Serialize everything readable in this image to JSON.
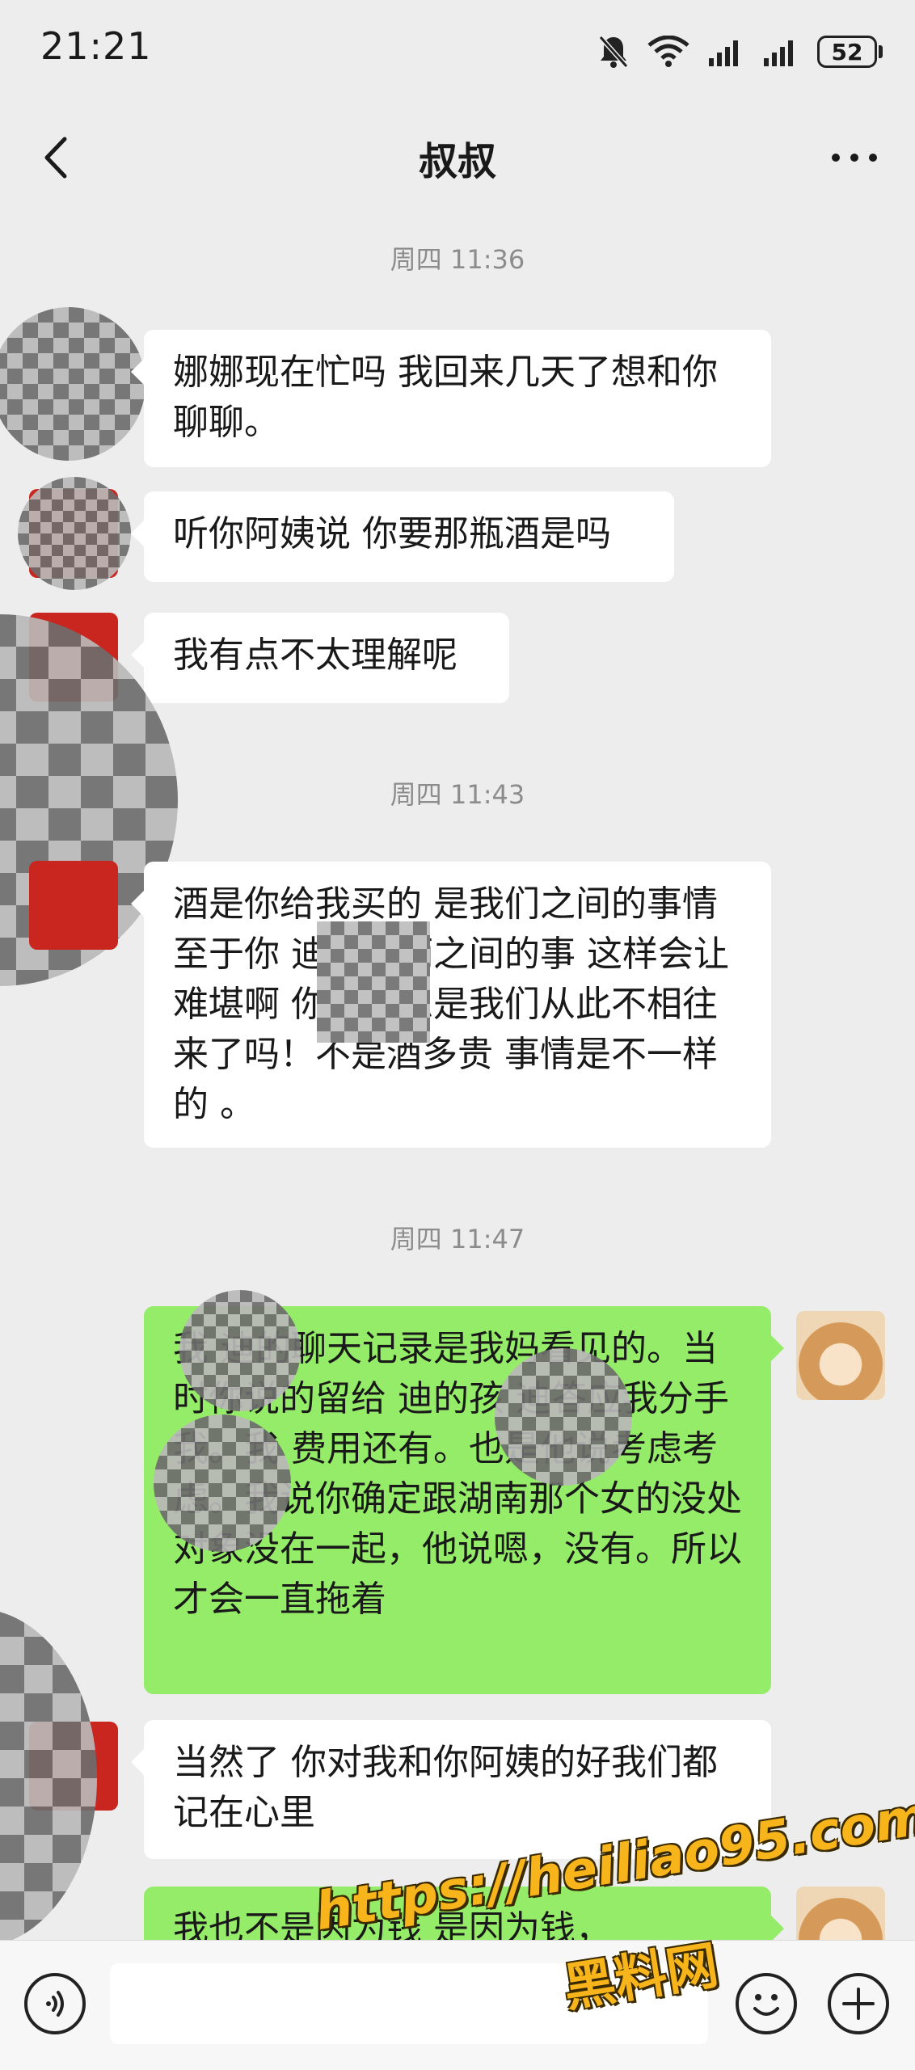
{
  "status_bar": {
    "time": "21:21",
    "battery": "52"
  },
  "header": {
    "title": "叔叔"
  },
  "chat": {
    "timestamps": [
      "周四 11:36",
      "周四 11:43",
      "周四 11:47"
    ],
    "messages": [
      {
        "side": "in",
        "text": "娜娜现在忙吗 我回来几天了想和你聊聊。"
      },
      {
        "side": "in",
        "text": "听你阿姨说 你要那瓶酒是吗"
      },
      {
        "side": "in",
        "text": "我有点不太理解呢"
      },
      {
        "side": "in",
        "text": "酒是你给我买的 是我们之间的事情 至于你 迪是你俩之间的事 这样会让 难堪啊 你的意思是我们从此不相往来了吗！不是酒多贵 事情是不一样的 。"
      },
      {
        "side": "out",
        "text": "我 迪的聊天记录是我妈看见的。当时你说的留给 迪的孩 迪答应我分手 我。我 费用还有。也是他说考虑考虑。我说你确定跟湖南那个女的没处对象没在一起，他说嗯，没有。所以才会一直拖着"
      },
      {
        "side": "in",
        "text": "当然了 你对我和你阿姨的好我们都记在心里"
      },
      {
        "side": "out",
        "text": "我也不是因为钱 是因为钱，"
      }
    ]
  },
  "watermark": {
    "url": "https://heiliao95.com",
    "name": "黑料网"
  },
  "icons": {
    "back": "chevron-left-icon",
    "more": "more-dots-icon",
    "voice": "voice-icon",
    "emoji": "emoji-icon",
    "plus": "plus-icon",
    "mute": "mute-bell-icon",
    "wifi": "wifi-icon",
    "signal": "signal-icon",
    "battery": "battery-icon"
  }
}
